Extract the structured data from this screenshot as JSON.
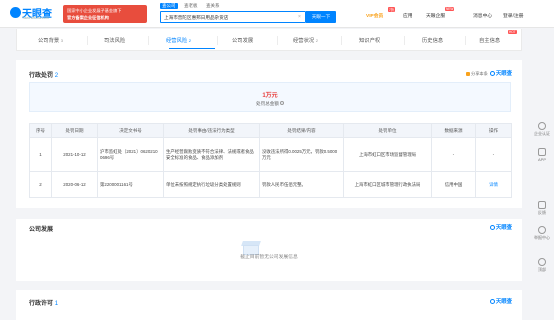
{
  "header": {
    "logo_text": "天眼查",
    "logo_sub": "TianYanCha.com",
    "banner_line1": "国家中小企业发展子基金旗下",
    "banner_line2": "官方备案企业征信机构",
    "search_tabs": [
      "查公司",
      "查老板",
      "查关系"
    ],
    "search_value": "上海市普陀区惠邦日用品杂货店",
    "search_button": "天眼一下",
    "vip_label": "VIP会员",
    "vip_badge": "7折",
    "nav_items": [
      "应用",
      "天眼企服",
      "消息中心",
      "登录/注册"
    ],
    "enterprise_badge": "NEW"
  },
  "subnav": {
    "tabs": [
      {
        "label": "公司背景",
        "count": "3"
      },
      {
        "label": "司法风险",
        "count": ""
      },
      {
        "label": "经营风险",
        "count": "2"
      },
      {
        "label": "公司发展",
        "count": ""
      },
      {
        "label": "经营状况",
        "count": "2"
      },
      {
        "label": "知识产权",
        "count": ""
      },
      {
        "label": "历史信息",
        "count": ""
      },
      {
        "label": "自主信息",
        "count": ""
      }
    ],
    "hot_badge": "HOT"
  },
  "penalty": {
    "title": "行政处罚",
    "count": "2",
    "share_label": "分享本条",
    "brand": "天眼查",
    "total_amount": "1万元",
    "total_label": "处罚总金额",
    "columns": [
      "序号",
      "处罚日期",
      "决定文书号",
      "处罚事由/违法行为类型",
      "处罚结果/内容",
      "处罚单位",
      "数据来源",
      "操作"
    ],
    "rows": [
      {
        "no": "1",
        "date": "2021-10-12",
        "doc": "沪市监虹处〔2021〕0620210 0696号",
        "reason": "生产经营腐败变质不符合法律、法规或者食品安全标准的食品、食品添加剂",
        "result": "没收违法所得0.0025万元，罚款0.5000万元",
        "unit": "上海市虹口区市场监督管理局",
        "source": "-",
        "action": "-"
      },
      {
        "no": "2",
        "date": "2020-06-12",
        "doc": "第2200001161号",
        "reason": "单位未按照规定执行垃圾分类处置规则",
        "result": "罚款人民币伍佰元整。",
        "unit": "上海市虹口区城市管理行政执法局",
        "source": "信用中国",
        "action": "详情"
      }
    ]
  },
  "development": {
    "title": "公司发展",
    "brand": "天眼查",
    "empty_text": "截止目前暂无公司发展信息"
  },
  "license": {
    "title": "行政许可",
    "count": "1",
    "brand": "天眼查"
  },
  "right_rail": [
    "企业认证",
    "APP",
    "反馈",
    "举报中心",
    "顶部"
  ]
}
